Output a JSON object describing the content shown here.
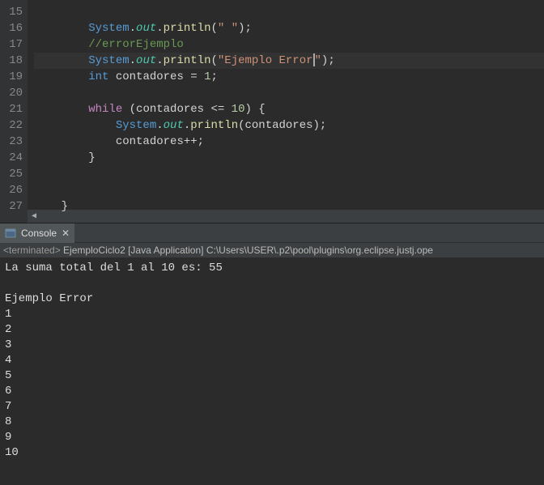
{
  "editor": {
    "lines": [
      {
        "num": "15",
        "indent": "        ",
        "tokens": []
      },
      {
        "num": "16",
        "indent": "        ",
        "tokens": [
          {
            "t": "System",
            "c": "tk-class"
          },
          {
            "t": ".",
            "c": "tk-punct"
          },
          {
            "t": "out",
            "c": "tk-field"
          },
          {
            "t": ".",
            "c": "tk-punct"
          },
          {
            "t": "println",
            "c": "tk-method"
          },
          {
            "t": "(",
            "c": "tk-punct"
          },
          {
            "t": "\" \"",
            "c": "tk-string"
          },
          {
            "t": ");",
            "c": "tk-punct"
          }
        ]
      },
      {
        "num": "17",
        "indent": "        ",
        "tokens": [
          {
            "t": "//errorEjemplo",
            "c": "tk-comment"
          }
        ]
      },
      {
        "num": "18",
        "indent": "        ",
        "current": true,
        "tokens": [
          {
            "t": "System",
            "c": "tk-class"
          },
          {
            "t": ".",
            "c": "tk-punct"
          },
          {
            "t": "out",
            "c": "tk-field"
          },
          {
            "t": ".",
            "c": "tk-punct"
          },
          {
            "t": "println",
            "c": "tk-method"
          },
          {
            "t": "(",
            "c": "tk-punct"
          },
          {
            "t": "\"Ejemplo Error",
            "c": "tk-string"
          },
          {
            "t": "",
            "cursor": true
          },
          {
            "t": "\"",
            "c": "tk-string"
          },
          {
            "t": ");",
            "c": "tk-punct"
          }
        ]
      },
      {
        "num": "19",
        "indent": "        ",
        "tokens": [
          {
            "t": "int",
            "c": "tk-type"
          },
          {
            "t": " ",
            "c": ""
          },
          {
            "t": "contadores",
            "c": "tk-var"
          },
          {
            "t": " = ",
            "c": "tk-op"
          },
          {
            "t": "1",
            "c": "tk-num"
          },
          {
            "t": ";",
            "c": "tk-punct"
          }
        ]
      },
      {
        "num": "20",
        "indent": "        ",
        "tokens": []
      },
      {
        "num": "21",
        "indent": "        ",
        "tokens": [
          {
            "t": "while",
            "c": "tk-keyword"
          },
          {
            "t": " (",
            "c": "tk-punct"
          },
          {
            "t": "contadores",
            "c": "tk-var"
          },
          {
            "t": " <= ",
            "c": "tk-op"
          },
          {
            "t": "10",
            "c": "tk-num"
          },
          {
            "t": ") {",
            "c": "tk-punct"
          }
        ]
      },
      {
        "num": "22",
        "indent": "            ",
        "tokens": [
          {
            "t": "System",
            "c": "tk-class"
          },
          {
            "t": ".",
            "c": "tk-punct"
          },
          {
            "t": "out",
            "c": "tk-field"
          },
          {
            "t": ".",
            "c": "tk-punct"
          },
          {
            "t": "println",
            "c": "tk-method"
          },
          {
            "t": "(",
            "c": "tk-punct"
          },
          {
            "t": "contadores",
            "c": "tk-var"
          },
          {
            "t": ");",
            "c": "tk-punct"
          }
        ]
      },
      {
        "num": "23",
        "indent": "            ",
        "tokens": [
          {
            "t": "contadores",
            "c": "tk-var"
          },
          {
            "t": "++;",
            "c": "tk-op"
          }
        ]
      },
      {
        "num": "24",
        "indent": "        ",
        "tokens": [
          {
            "t": "}",
            "c": "tk-punct"
          }
        ]
      },
      {
        "num": "25",
        "indent": "        ",
        "tokens": []
      },
      {
        "num": "26",
        "indent": "        ",
        "tokens": []
      },
      {
        "num": "27",
        "indent": "    ",
        "tokens": [
          {
            "t": "}",
            "c": "tk-punct"
          }
        ]
      }
    ]
  },
  "tabs": {
    "console": {
      "label": "Console"
    }
  },
  "status": {
    "terminated": "<terminated>",
    "text": " EjemploCiclo2 [Java Application] C:\\Users\\USER\\.p2\\pool\\plugins\\org.eclipse.justj.ope"
  },
  "console": {
    "lines": [
      "La suma total del 1 al 10 es: 55",
      "",
      "Ejemplo Error",
      "1",
      "2",
      "3",
      "4",
      "5",
      "6",
      "7",
      "8",
      "9",
      "10"
    ]
  }
}
